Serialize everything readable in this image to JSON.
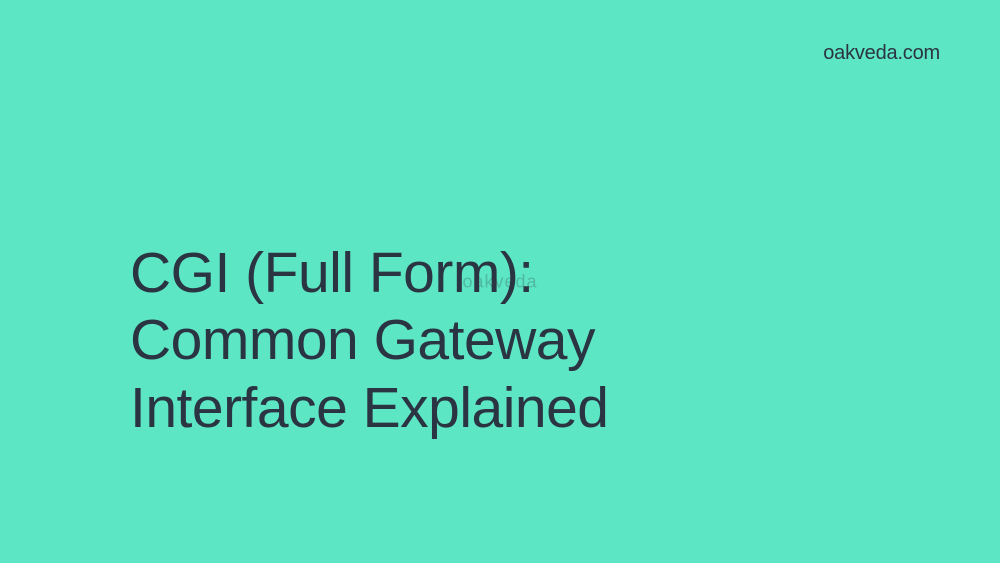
{
  "brand": "oakveda.com",
  "title_line1": "CGI (Full Form):",
  "title_line2": "Common Gateway",
  "title_line3": "Interface Explained",
  "watermark": "oakveda"
}
